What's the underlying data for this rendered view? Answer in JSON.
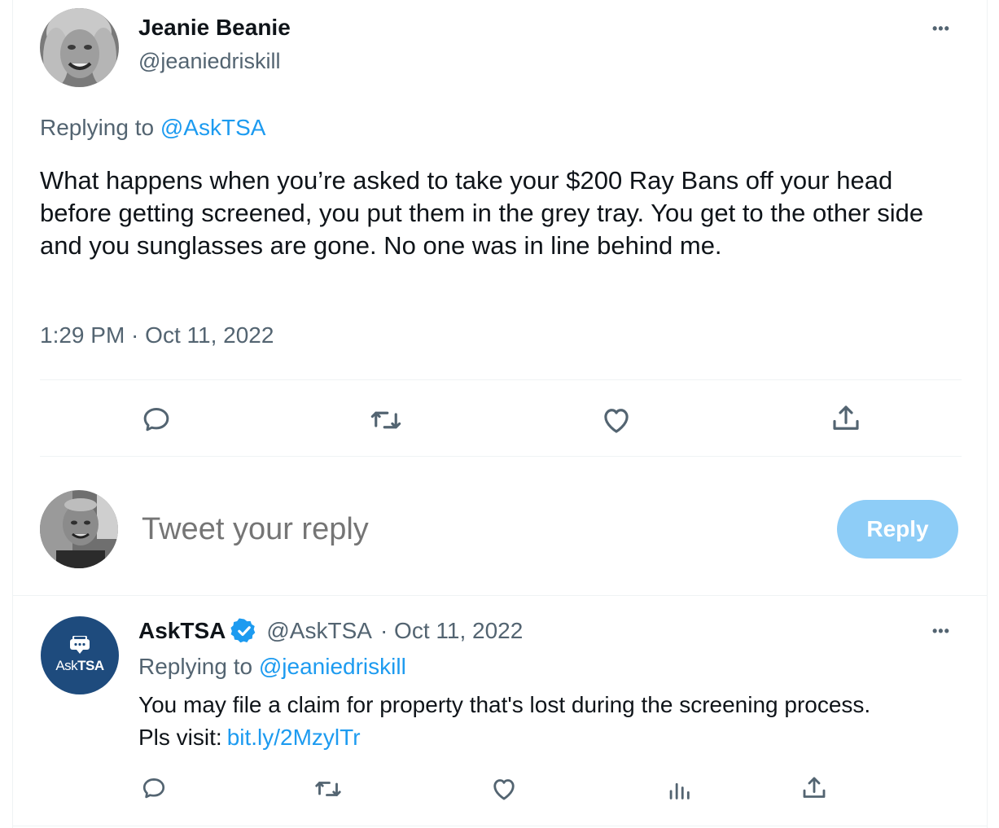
{
  "main_tweet": {
    "author_name": "Jeanie Beanie",
    "author_handle": "@jeaniedriskill",
    "replying_prefix": "Replying to",
    "replying_to": "@AskTSA",
    "text": "What happens when you’re asked to take your $200 Ray Bans off your head before getting screened, you put them in the grey tray. You get to the other side and you sunglasses are gone. No one was in line behind me.",
    "timestamp": "1:29 PM · Oct 11, 2022",
    "more_label": "•••",
    "actions": [
      "reply-icon",
      "retweet-icon",
      "like-icon",
      "share-icon"
    ]
  },
  "composer": {
    "placeholder": "Tweet your reply",
    "button_label": "Reply",
    "button_color": "#8ecdf7"
  },
  "reply_tweet": {
    "author_name": "AskTSA",
    "verified": true,
    "author_handle": "@AskTSA",
    "date": "· Oct 11, 2022",
    "avatar_text_prefix": "Ask",
    "avatar_text_bold": "TSA",
    "replying_prefix": "Replying to",
    "replying_to": "@jeaniedriskill",
    "text_line1": "You may file a claim for property that's lost during the screening process.",
    "text_line2_prefix": "Pls visit:",
    "link": "bit.ly/2MzylTr",
    "more_label": "•••",
    "actions": [
      "reply-icon",
      "retweet-icon",
      "like-icon",
      "analytics-icon",
      "share-icon"
    ]
  },
  "colors": {
    "accent": "#1d9bf0",
    "muted": "#536471",
    "askTSA_avatar": "#1e4b7d"
  }
}
